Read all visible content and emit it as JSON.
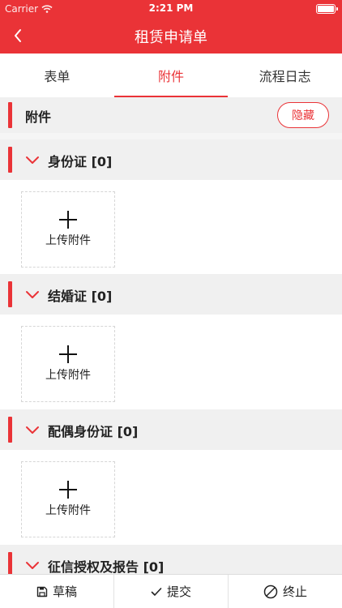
{
  "status_bar": {
    "carrier": "Carrier",
    "time": "2:21 PM"
  },
  "nav": {
    "title": "租赁申请单",
    "back_icon": "chevron-left-icon"
  },
  "tabs": [
    {
      "label": "表单",
      "active": false
    },
    {
      "label": "附件",
      "active": true
    },
    {
      "label": "流程日志",
      "active": false
    }
  ],
  "attachments": {
    "title": "附件",
    "hide_label": "隐藏"
  },
  "sections": [
    {
      "title": "身份证 [0]",
      "upload_label": "上传附件"
    },
    {
      "title": "结婚证 [0]",
      "upload_label": "上传附件"
    },
    {
      "title": "配偶身份证 [0]",
      "upload_label": "上传附件"
    },
    {
      "title": "征信授权及报告 [0]"
    }
  ],
  "bottom_bar": {
    "draft": "草稿",
    "submit": "提交",
    "terminate": "终止"
  },
  "colors": {
    "accent": "#ea3337",
    "section_bg": "#f0f0f0"
  }
}
